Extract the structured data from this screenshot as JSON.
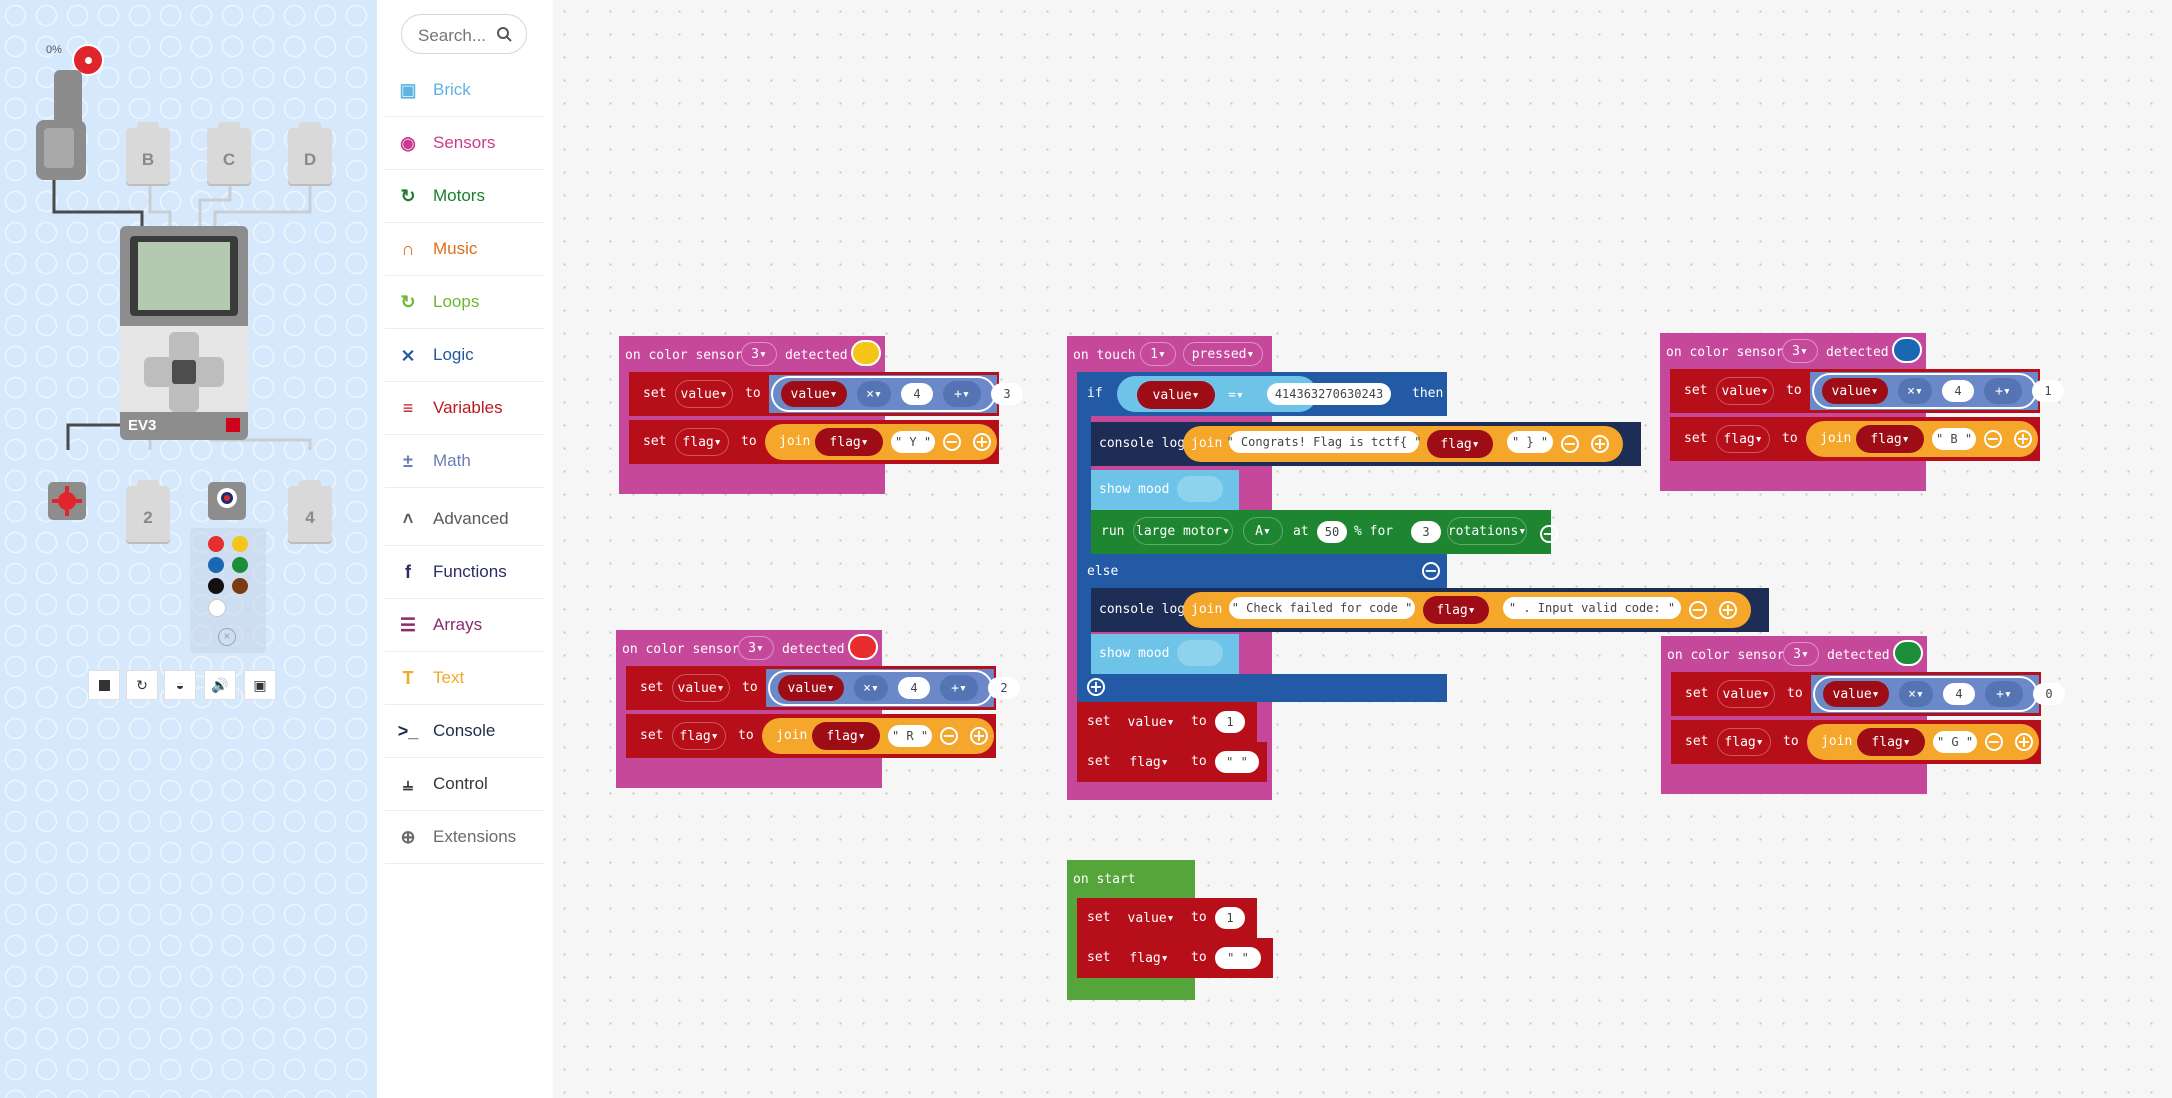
{
  "toolbox": {
    "search_placeholder": "Search...",
    "categories": [
      {
        "label": "Brick",
        "color": "#5fb4e2",
        "icon": "brick-icon"
      },
      {
        "label": "Sensors",
        "color": "#c83c8e",
        "icon": "sensors-icon"
      },
      {
        "label": "Motors",
        "color": "#1a7f2a",
        "icon": "motors-icon"
      },
      {
        "label": "Music",
        "color": "#e06d17",
        "icon": "music-icon"
      },
      {
        "label": "Loops",
        "color": "#6cb834",
        "icon": "loops-icon"
      },
      {
        "label": "Logic",
        "color": "#23579e",
        "icon": "logic-icon"
      },
      {
        "label": "Variables",
        "color": "#b81a21",
        "icon": "variables-icon"
      },
      {
        "label": "Math",
        "color": "#6b7db3",
        "icon": "math-icon"
      },
      {
        "label": "Advanced",
        "color": "#5a5a5a",
        "icon": "chevron-up-icon"
      },
      {
        "label": "Functions",
        "color": "#2c2c68",
        "icon": "functions-icon"
      },
      {
        "label": "Arrays",
        "color": "#8a2b6e",
        "icon": "arrays-icon"
      },
      {
        "label": "Text",
        "color": "#f1a928",
        "icon": "text-icon"
      },
      {
        "label": "Console",
        "color": "#1f2d4a",
        "icon": "console-icon"
      },
      {
        "label": "Control",
        "color": "#37363a",
        "icon": "control-icon"
      },
      {
        "label": "Extensions",
        "color": "#6b6b6b",
        "icon": "extensions-icon"
      }
    ]
  },
  "simulator": {
    "percent": "0%",
    "ports_top": [
      "B",
      "C",
      "D"
    ],
    "ports_bottom": [
      "2",
      "4"
    ],
    "brick_label": "EV3",
    "colors": [
      "#e72d2d",
      "#f5c518",
      "#1a68b3",
      "#1c8e3a",
      "#111111",
      "#7b3b12",
      "#ffffff"
    ]
  },
  "blocks": {
    "kw": {
      "set": "set",
      "to": "to",
      "join": "join",
      "value": "value",
      "flag": "flag",
      "times": "×",
      "plus": "+",
      "on_color_sensor": "on color sensor",
      "detected": "detected",
      "sensor_port": "3",
      "on_touch": "on touch",
      "touch_port": "1",
      "pressed": "pressed",
      "if": "if",
      "eq": "=",
      "then": "then",
      "else": "else",
      "console_log": "console log",
      "show_mood": "show mood",
      "run": "run",
      "large_motor": "large motor",
      "motor_port": "A",
      "at": "at",
      "speed": "50",
      "percent_for": "% for",
      "rotations_count": "3",
      "rotations": "rotations",
      "on_start": "on start",
      "four": "4"
    },
    "yellow": {
      "chip_color": "#f5c518",
      "add": "3",
      "letter": "\" Y \""
    },
    "red": {
      "chip_color": "#e72d2d",
      "add": "2",
      "letter": "\" R \""
    },
    "blue": {
      "chip_color": "#1a68b3",
      "add": "1",
      "letter": "\" B \""
    },
    "green": {
      "chip_color": "#1c8e3a",
      "add": "0",
      "letter": "\" G \""
    },
    "touch": {
      "code": "414363270630243",
      "msg1": "\" Congrats! Flag is tctf{ \"",
      "brace": "\" } \"",
      "msg2": "\" Check failed for code \"",
      "msg3": "\" . Input valid code: \"",
      "reset_value": "1",
      "empty_str": "\"  \""
    },
    "start": {
      "value": "1",
      "empty_str": "\"  \""
    }
  }
}
